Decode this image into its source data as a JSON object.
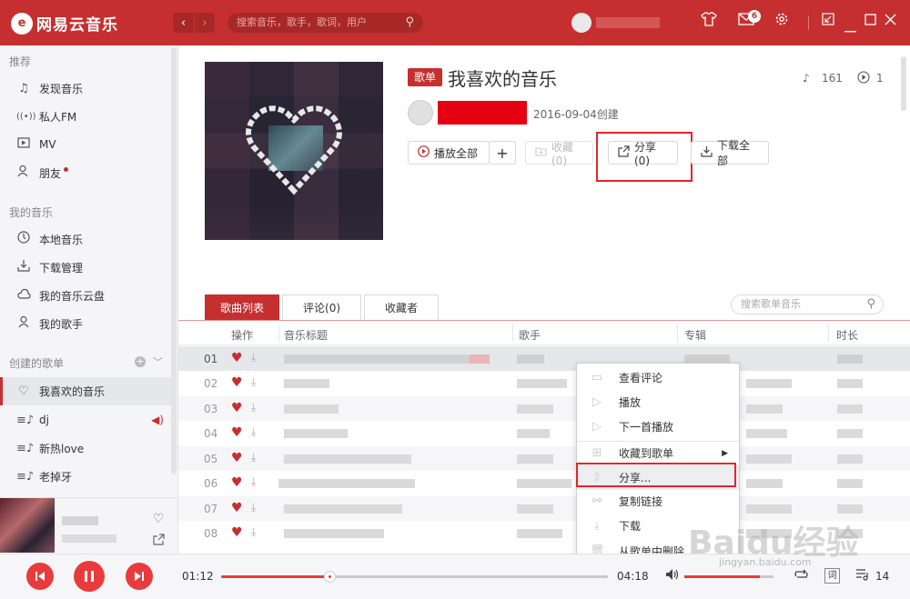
{
  "app": {
    "name": "网易云音乐",
    "logo_glyph": "e"
  },
  "search": {
    "placeholder": "搜索音乐，歌手，歌词，用户"
  },
  "nav": {
    "back": "‹",
    "forward": "›"
  },
  "header": {
    "message_count": "6"
  },
  "sidebar": {
    "sections": [
      {
        "title": "推荐"
      },
      {
        "title": "我的音乐"
      },
      {
        "title": "创建的歌单"
      }
    ],
    "recommend": [
      {
        "label": "发现音乐",
        "icon": "music-note-icon"
      },
      {
        "label": "私人FM",
        "icon": "radio-icon"
      },
      {
        "label": "MV",
        "icon": "video-icon"
      },
      {
        "label": "朋友",
        "icon": "friends-icon"
      }
    ],
    "my_music": [
      {
        "label": "本地音乐",
        "icon": "local-music-icon"
      },
      {
        "label": "下载管理",
        "icon": "download-icon"
      },
      {
        "label": "我的音乐云盘",
        "icon": "cloud-icon"
      },
      {
        "label": "我的歌手",
        "icon": "singer-icon"
      }
    ],
    "playlists": [
      {
        "label": "我喜欢的音乐",
        "active": true
      },
      {
        "label": "dj",
        "playing": true
      },
      {
        "label": "新热love"
      },
      {
        "label": "老掉牙"
      }
    ]
  },
  "playlist": {
    "tag": "歌单",
    "title": "我喜欢的音乐",
    "song_count": "161",
    "play_count": "1",
    "created": "2016-09-04创建",
    "buttons": {
      "play_all": "播放全部",
      "add": "+",
      "collect": "收藏(0)",
      "share": "分享(0)",
      "download_all": "下载全部"
    }
  },
  "tabs": [
    {
      "label": "歌曲列表",
      "active": true
    },
    {
      "label": "评论(0)"
    },
    {
      "label": "收藏者"
    }
  ],
  "song_search": {
    "placeholder": "搜索歌单音乐"
  },
  "table": {
    "columns": [
      "操作",
      "音乐标题",
      "歌手",
      "专辑",
      "时长"
    ],
    "rows": [
      {
        "index": "01"
      },
      {
        "index": "02"
      },
      {
        "index": "03"
      },
      {
        "index": "04"
      },
      {
        "index": "05"
      },
      {
        "index": "06"
      },
      {
        "index": "07"
      },
      {
        "index": "08"
      }
    ]
  },
  "context_menu": {
    "items": [
      {
        "label": "查看评论",
        "icon": "comment-icon"
      },
      {
        "label": "播放",
        "icon": "play-icon"
      },
      {
        "label": "下一首播放",
        "icon": "play-next-icon"
      },
      {
        "label": "收藏到歌单",
        "icon": "add-to-playlist-icon",
        "submenu": true
      },
      {
        "label": "分享...",
        "icon": "share-icon",
        "highlighted": true
      },
      {
        "label": "复制链接",
        "icon": "link-icon"
      },
      {
        "label": "下载",
        "icon": "download-icon"
      },
      {
        "label": "从歌单中删除",
        "icon": "trash-icon"
      }
    ]
  },
  "player": {
    "current_time": "01:12",
    "total_time": "04:18",
    "progress": 0.28,
    "volume": 0.85,
    "lyric_label": "词",
    "queue_count": "14"
  },
  "watermark": {
    "text": "Baidu经验",
    "sub": "jingyan.baidu.com"
  },
  "colors": {
    "brand": "#c62f2f",
    "accent": "#e83c3c",
    "highlight_box": "#e5252b"
  }
}
